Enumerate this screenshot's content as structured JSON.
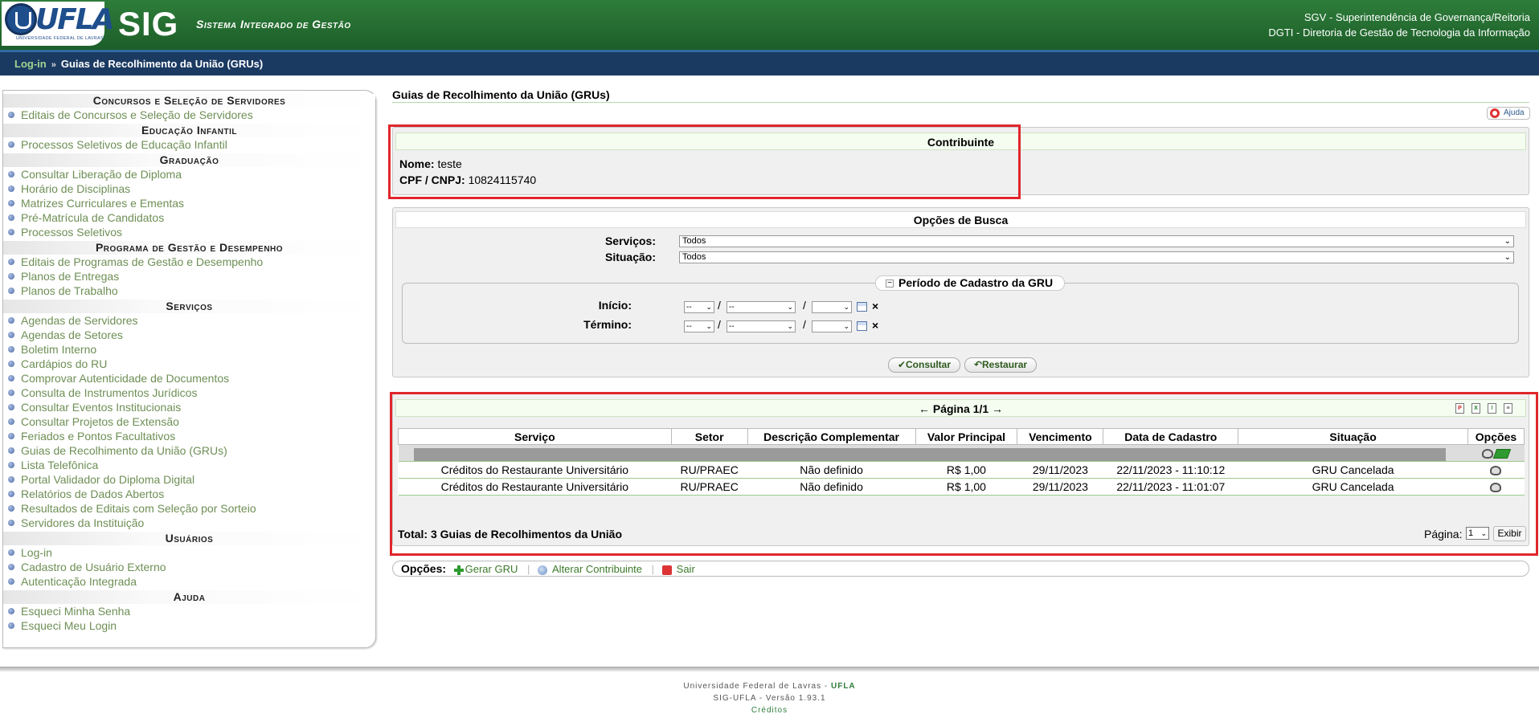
{
  "header": {
    "logo_text": "UFLA",
    "logo_sub": "UNIVERSIDADE FEDERAL DE LAVRAS",
    "sig": "SIG",
    "subtitle": "Sistema Integrado de Gestão",
    "org1": "SGV - Superintendência de Governança/Reitoria",
    "org2": "DGTI - Diretoria de Gestão de Tecnologia da Informação"
  },
  "breadcrumb": {
    "login": "Log-in",
    "sep": "»",
    "current": "Guias de Recolhimento da União (GRUs)"
  },
  "sidebar": {
    "sections": [
      {
        "title": "Concursos e Seleção de Servidores",
        "items": [
          "Editais de Concursos e Seleção de Servidores"
        ]
      },
      {
        "title": "Educação Infantil",
        "items": [
          "Processos Seletivos de Educação Infantil"
        ]
      },
      {
        "title": "Graduação",
        "items": [
          "Consultar Liberação de Diploma",
          "Horário de Disciplinas",
          "Matrizes Curriculares e Ementas",
          "Pré-Matrícula de Candidatos",
          "Processos Seletivos"
        ]
      },
      {
        "title": "Programa de Gestão e Desempenho",
        "items": [
          "Editais de Programas de Gestão e Desempenho",
          "Planos de Entregas",
          "Planos de Trabalho"
        ]
      },
      {
        "title": "Serviços",
        "items": [
          "Agendas de Servidores",
          "Agendas de Setores",
          "Boletim Interno",
          "Cardápios do RU",
          "Comprovar Autenticidade de Documentos",
          "Consulta de Instrumentos Jurídicos",
          "Consultar Eventos Institucionais",
          "Consultar Projetos de Extensão",
          "Feriados e Pontos Facultativos",
          "Guias de Recolhimento da União (GRUs)",
          "Lista Telefônica",
          "Portal Validador do Diploma Digital",
          "Relatórios de Dados Abertos",
          "Resultados de Editais com Seleção por Sorteio",
          "Servidores da Instituição"
        ]
      },
      {
        "title": "Usuários",
        "items": [
          "Log-in",
          "Cadastro de Usuário Externo",
          "Autenticação Integrada"
        ]
      },
      {
        "title": "Ajuda",
        "items": [
          "Esqueci Minha Senha",
          "Esqueci Meu Login"
        ]
      }
    ]
  },
  "main": {
    "title": "Guias de Recolhimento da União (GRUs)",
    "help": "Ajuda",
    "contribuinte": {
      "header": "Contribuinte",
      "nome_label": "Nome:",
      "nome": "teste",
      "cpf_label": "CPF / CNPJ:",
      "cpf": "10824115740"
    },
    "busca": {
      "header": "Opções de Busca",
      "servicos_label": "Serviços:",
      "servicos_value": "Todos",
      "situacao_label": "Situação:",
      "situacao_value": "Todos",
      "periodo_title": "Período de Cadastro da GRU",
      "toggle": "−",
      "inicio_label": "Início:",
      "termino_label": "Término:",
      "day_value": "--",
      "month_value": "--",
      "year_value": "",
      "slash": "/",
      "clear": "×",
      "consultar": "Consultar",
      "restaurar": "Restaurar"
    },
    "results": {
      "pagination": "← Página 1/1 →",
      "columns": [
        "Serviço",
        "Setor",
        "Descrição Complementar",
        "Valor Principal",
        "Vencimento",
        "Data de Cadastro",
        "Situação",
        "Opções"
      ],
      "rows": [
        [
          "Créditos do Restaurante Universitário",
          "RU/PRAEC",
          "Não definido",
          "R$ 1,00",
          "29/11/2023",
          "22/11/2023 - 11:10:12",
          "GRU Cancelada"
        ],
        [
          "Créditos do Restaurante Universitário",
          "RU/PRAEC",
          "Não definido",
          "R$ 1,00",
          "29/11/2023",
          "22/11/2023 - 11:01:07",
          "GRU Cancelada"
        ]
      ],
      "total": "Total: 3 Guias de Recolhimentos da União",
      "page_label": "Página:",
      "page_value": "1",
      "exibir": "Exibir"
    },
    "opcoes": {
      "label": "Opções:",
      "gerar": "Gerar GRU",
      "alterar": "Alterar Contribuinte",
      "sair": "Sair"
    }
  },
  "footer": {
    "line1_pre": "Universidade Federal de Lavras - ",
    "line1_strong": "UFLA",
    "line2": "SIG-UFLA - Versão 1.93.1",
    "line3": "Créditos"
  },
  "colors": {
    "header_green": "#2e7d3a",
    "breadcrumb_blue": "#1b3a62",
    "link_green": "#6e8f55",
    "highlight_red": "#e0262c"
  }
}
